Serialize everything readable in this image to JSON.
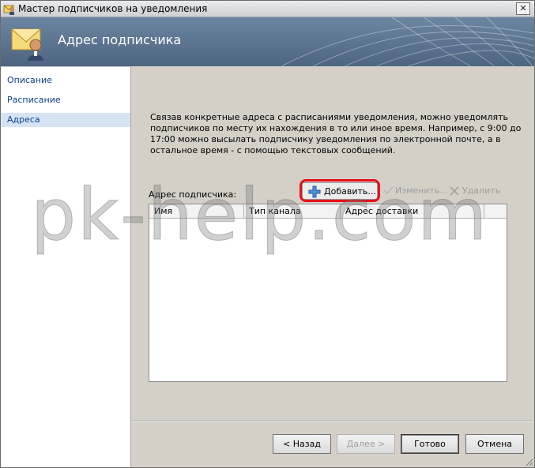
{
  "window": {
    "title": "Мастер подписчиков на уведомления",
    "close_glyph": "✕",
    "icon": "subscriber-wizard-icon"
  },
  "header": {
    "title": "Адрес подписчика",
    "icon": "envelope-user-icon"
  },
  "nav": {
    "items": [
      {
        "label": "Описание",
        "selected": false
      },
      {
        "label": "Расписание",
        "selected": false
      },
      {
        "label": "Адреса",
        "selected": true
      }
    ]
  },
  "content": {
    "description": "Связав конкретные адреса с расписаниями уведомления, можно уведомлять подписчиков по месту их нахождения в то или иное время. Например, с 9:00 до 17:00 можно высылать подписчику уведомления по электронной почте, а в остальное время - с помощью текстовых сообщений.",
    "address_label": "Адрес подписчика:",
    "add_button": "Добавить...",
    "edit_button": "Изменить...",
    "delete_button": "Удалить",
    "columns": [
      "Имя",
      "Тип канала",
      "Адрес доставки"
    ],
    "rows": []
  },
  "footer": {
    "back": "< Назад",
    "next": "Далее >",
    "finish": "Готово",
    "cancel": "Отмена"
  },
  "watermark": "pk-help.com",
  "colors": {
    "highlight": "#e8101b",
    "header_bg": "#5b7491",
    "nav_link": "#0b3f8c",
    "nav_selected_bg": "#d7e3f3"
  }
}
